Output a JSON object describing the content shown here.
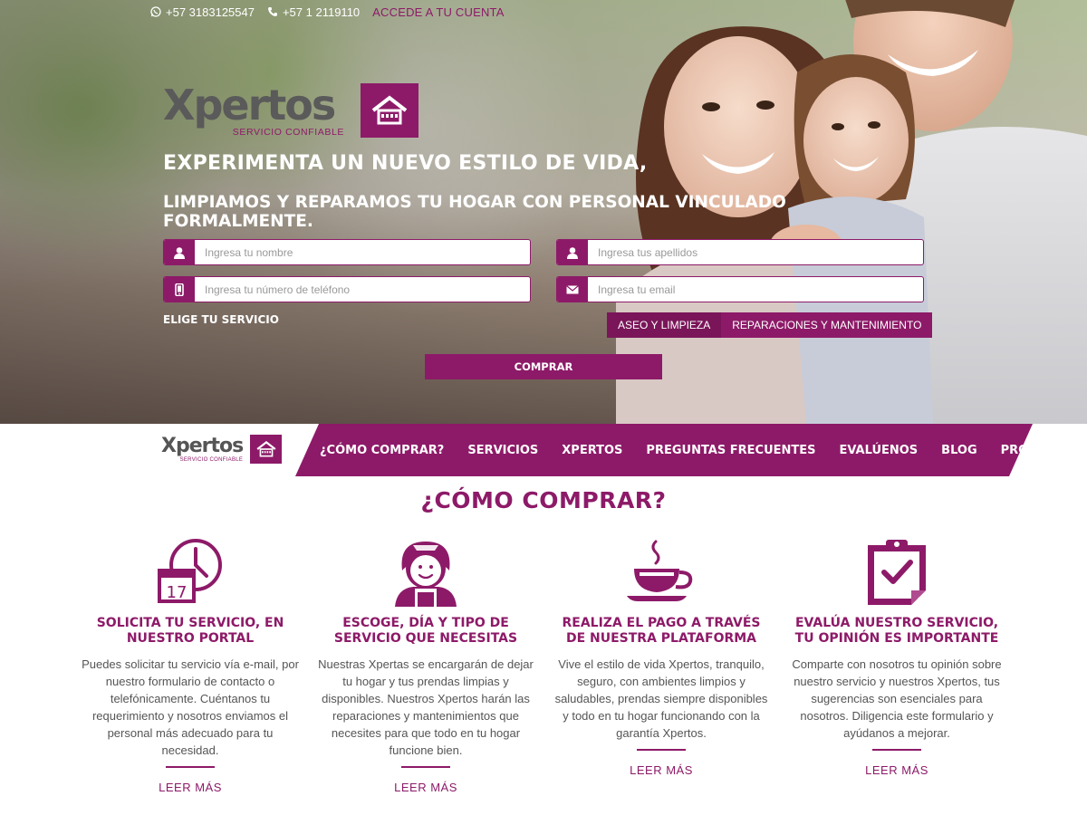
{
  "topbar": {
    "whatsapp": "+57 3183125547",
    "phone": "+57 1 2119110",
    "account_link": "ACCEDE A TU CUENTA"
  },
  "brand": {
    "name": "Xpertos",
    "tagline": "SERVICIO CONFIABLE"
  },
  "hero": {
    "headline": "EXPERIMENTA UN NUEVO ESTILO DE VIDA,",
    "subheadline": "LIMPIAMOS Y REPARAMOS TU HOGAR CON PERSONAL VINCULADO FORMALMENTE."
  },
  "form": {
    "name_placeholder": "Ingresa tu nombre",
    "lastname_placeholder": "Ingresa tus apellidos",
    "phone_placeholder": "Ingresa tu número de teléfono",
    "email_placeholder": "Ingresa tu email",
    "service_label": "ELIGE TU SERVICIO",
    "services": [
      "ASEO Y LIMPIEZA",
      "REPARACIONES Y MANTENIMIENTO"
    ],
    "submit": "COMPRAR"
  },
  "nav": {
    "items": [
      "¿CÓMO COMPRAR?",
      "SERVICIOS",
      "XPERTOS",
      "PREGUNTAS FRECUENTES",
      "EVALÚENOS",
      "BLOG",
      "PROMOS"
    ]
  },
  "how": {
    "title": "¿CÓMO COMPRAR?",
    "steps": [
      {
        "icon": "calendar-clock-icon",
        "calendar_day": "17",
        "title": "SOLICITA TU SERVICIO, EN NUESTRO PORTAL",
        "text": "Puedes solicitar tu servicio vía e-mail, por nuestro formulario de contacto o telefónicamente. Cuéntanos tu requerimiento y nosotros enviamos el personal más adecuado para tu necesidad.",
        "link": "LEER MÁS"
      },
      {
        "icon": "housekeeper-icon",
        "title": "ESCOGE, DÍA Y TIPO DE SERVICIO QUE NECESITAS",
        "text": "Nuestras Xpertas se encargarán de dejar tu hogar y tus prendas limpias y disponibles. Nuestros Xpertos harán las reparaciones y mantenimientos que necesites para que todo en tu hogar funcione bien.",
        "link": "LEER MÁS"
      },
      {
        "icon": "coffee-cup-icon",
        "title": "REALIZA EL PAGO A TRAVÉS DE NUESTRA PLATAFORMA",
        "text": "Vive el estilo de vida Xpertos, tranquilo, seguro, con ambientes limpios y saludables, prendas siempre disponibles y todo en tu hogar funcionando con la garantía Xpertos.",
        "link": "LEER MÁS"
      },
      {
        "icon": "checklist-clipboard-icon",
        "title": "EVALÚA NUESTRO SERVICIO, TU OPINIÓN ES IMPORTANTE",
        "text": "Comparte con nosotros tu opinión sobre nuestro servicio y nuestros Xpertos, tus sugerencias son esenciales para nosotros. Diligencia este formulario y ayúdanos a mejorar.",
        "link": "LEER MÁS"
      }
    ]
  },
  "colors": {
    "brand": "#8d1a68",
    "brand_dark": "#7a1559",
    "logo_gray": "#5a5a5a"
  }
}
